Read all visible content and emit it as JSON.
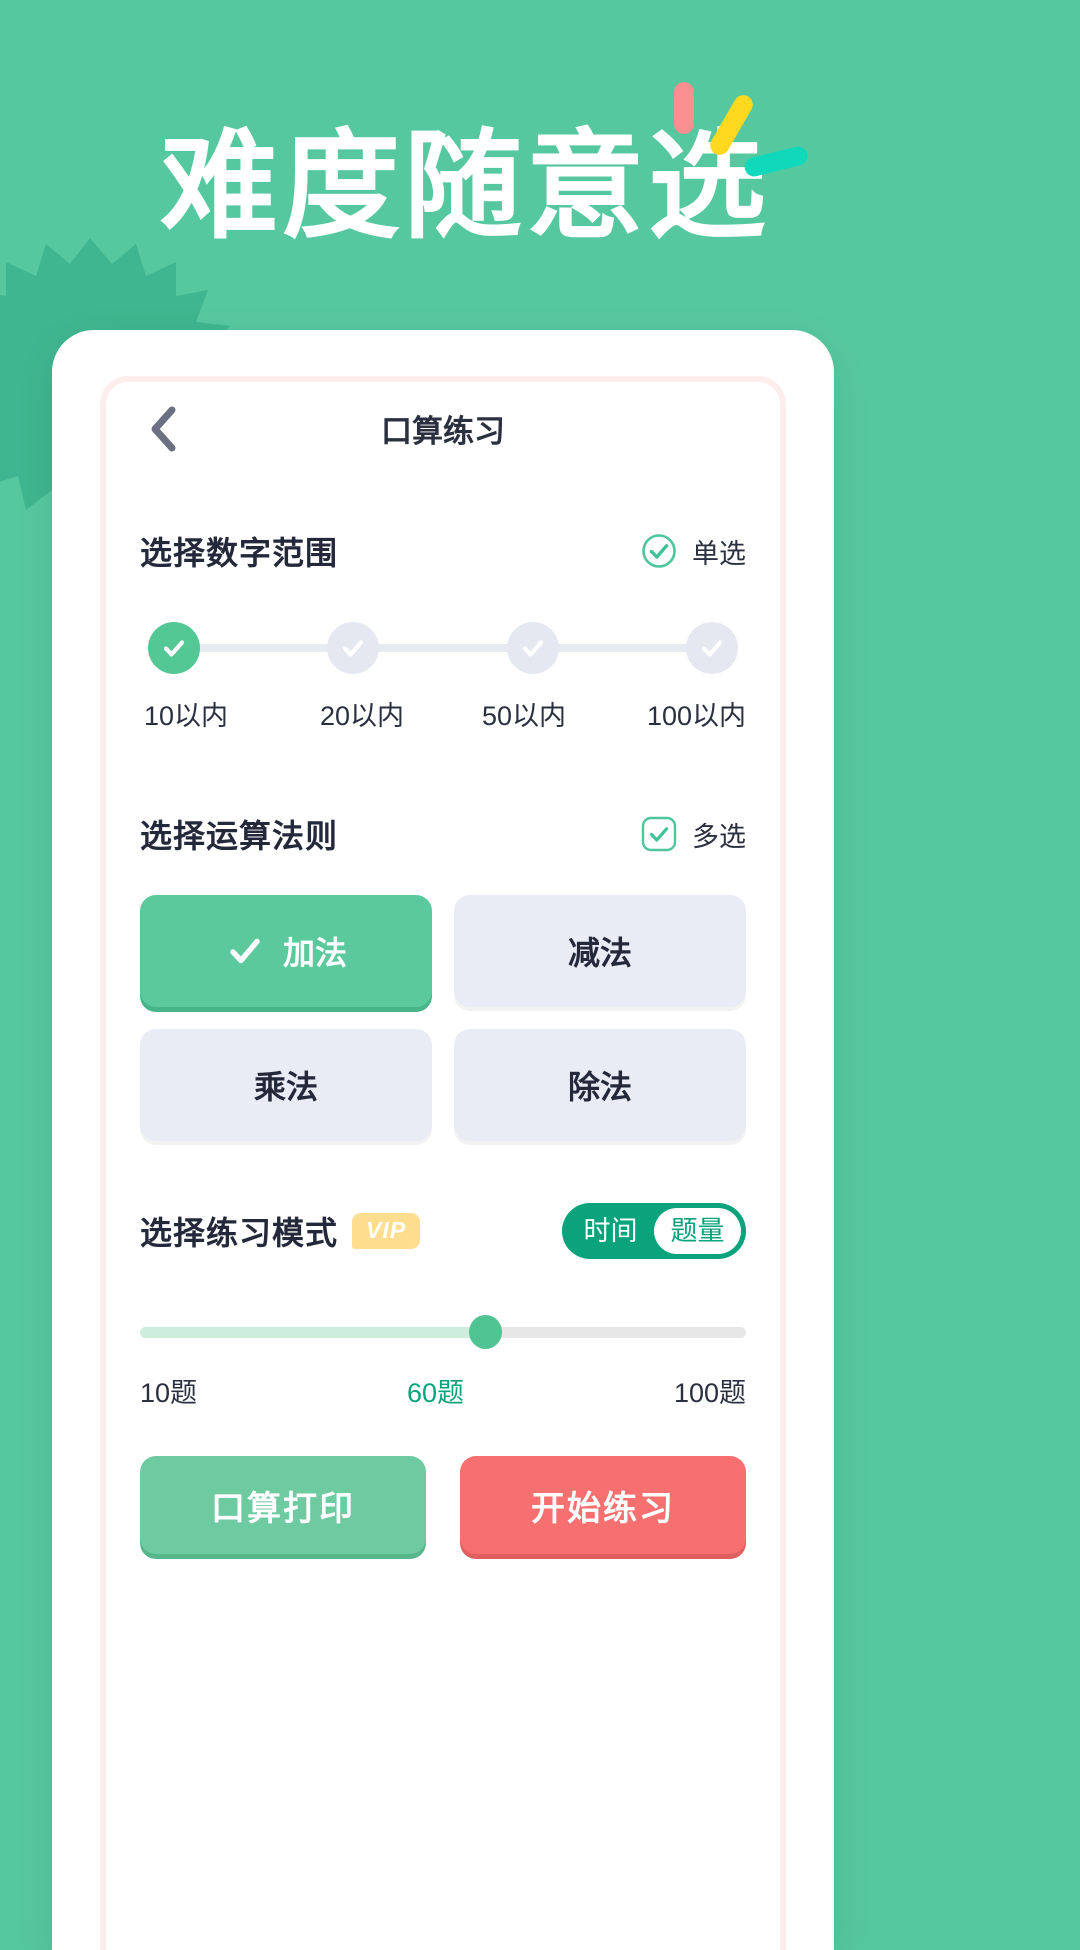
{
  "colors": {
    "background": "#56c8a0",
    "accent_green": "#53c894",
    "accent_teal": "#0aa37c",
    "accent_red": "#f6706f",
    "confetti_pink": "#f98f8f",
    "confetti_yellow": "#ffd920",
    "confetti_teal": "#10d9bb",
    "vip_yellow": "#ffdd8e"
  },
  "hero": {
    "title": "难度随意选"
  },
  "navbar": {
    "title": "口算练习",
    "back_icon": "chevron-left-icon"
  },
  "range_section": {
    "title": "选择数字范围",
    "mode_label": "单选",
    "mode_icon": "circle-check-icon",
    "options": [
      {
        "label": "10以内",
        "selected": true
      },
      {
        "label": "20以内",
        "selected": false
      },
      {
        "label": "50以内",
        "selected": false
      },
      {
        "label": "100以内",
        "selected": false
      }
    ]
  },
  "operation_section": {
    "title": "选择运算法则",
    "mode_label": "多选",
    "mode_icon": "square-check-icon",
    "options": [
      {
        "label": "加法",
        "selected": true
      },
      {
        "label": "减法",
        "selected": false
      },
      {
        "label": "乘法",
        "selected": false
      },
      {
        "label": "除法",
        "selected": false
      }
    ]
  },
  "practice_section": {
    "title": "选择练习模式",
    "vip_badge": "VIP",
    "toggle": {
      "options": [
        "时间",
        "题量"
      ],
      "selected": "题量"
    },
    "slider": {
      "min_label": "10题",
      "current_label": "60题",
      "max_label": "100题",
      "percent": 57
    }
  },
  "bottom_buttons": {
    "print": "口算打印",
    "start": "开始练习"
  }
}
